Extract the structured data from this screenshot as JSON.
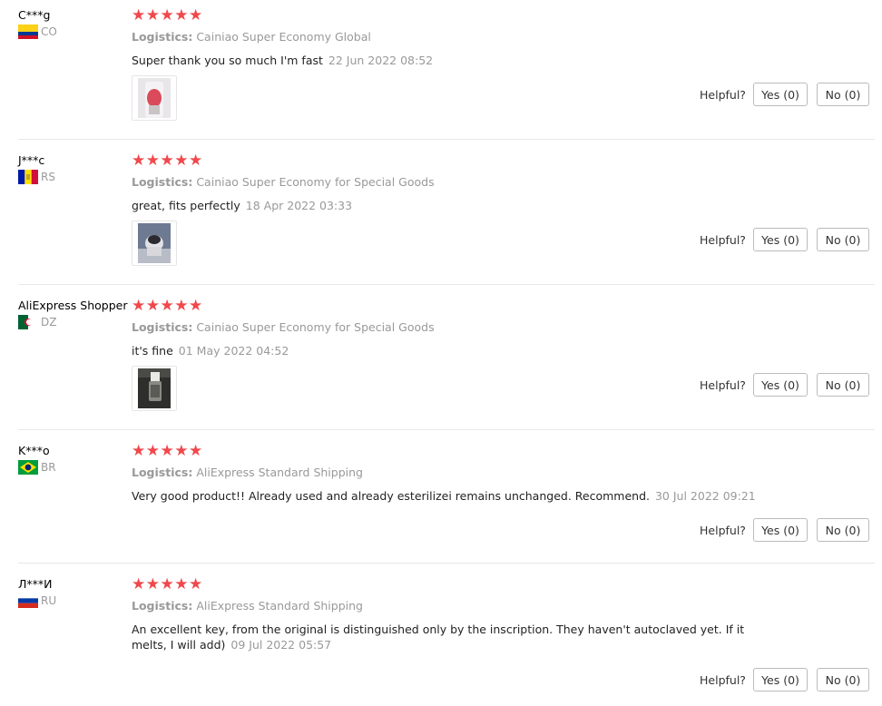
{
  "helpful_label": "Helpful?",
  "reviews": [
    {
      "user": "C***g",
      "country": "CO",
      "flag": "flag-colombia",
      "stars": "★★★★★",
      "rating": 5,
      "logistics_label": "Logistics:",
      "logistics": "Cainiao Super Economy Global",
      "text": "Super thank you so much I'm fast",
      "date": "22 Jun 2022 08:52",
      "has_photo": true,
      "yes": "Yes (0)",
      "no": "No (0)"
    },
    {
      "user": "J***c",
      "country": "RS",
      "flag": "flag-rs",
      "stars": "★★★★★",
      "rating": 5,
      "logistics_label": "Logistics:",
      "logistics": "Cainiao Super Economy for Special Goods",
      "text": "great, fits perfectly",
      "date": "18 Apr 2022 03:33",
      "has_photo": true,
      "yes": "Yes (0)",
      "no": "No (0)"
    },
    {
      "user": "AliExpress Shopper",
      "country": "DZ",
      "flag": "flag-algeria",
      "stars": "★★★★★",
      "rating": 5,
      "logistics_label": "Logistics:",
      "logistics": "Cainiao Super Economy for Special Goods",
      "text": "it's fine",
      "date": "01 May 2022 04:52",
      "has_photo": true,
      "yes": "Yes (0)",
      "no": "No (0)"
    },
    {
      "user": "K***o",
      "country": "BR",
      "flag": "flag-brazil",
      "stars": "★★★★★",
      "rating": 5,
      "logistics_label": "Logistics:",
      "logistics": "AliExpress Standard Shipping",
      "text": "Very good product!! Already used and already esterilizei remains unchanged. Recommend.",
      "date": "30 Jul 2022 09:21",
      "has_photo": false,
      "yes": "Yes (0)",
      "no": "No (0)"
    },
    {
      "user": "Л***И",
      "country": "RU",
      "flag": "flag-russia",
      "stars": "★★★★★",
      "rating": 5,
      "logistics_label": "Logistics:",
      "logistics": "AliExpress Standard Shipping",
      "text": "An excellent key, from the original is distinguished only by the inscription. They haven't autoclaved yet. If it melts, I will add)",
      "date": "09 Jul 2022 05:57",
      "has_photo": false,
      "yes": "Yes (0)",
      "no": "No (0)"
    }
  ],
  "colors": {
    "star": "#f0484c",
    "muted_text": "#999999",
    "divider": "#e8e8e8"
  }
}
